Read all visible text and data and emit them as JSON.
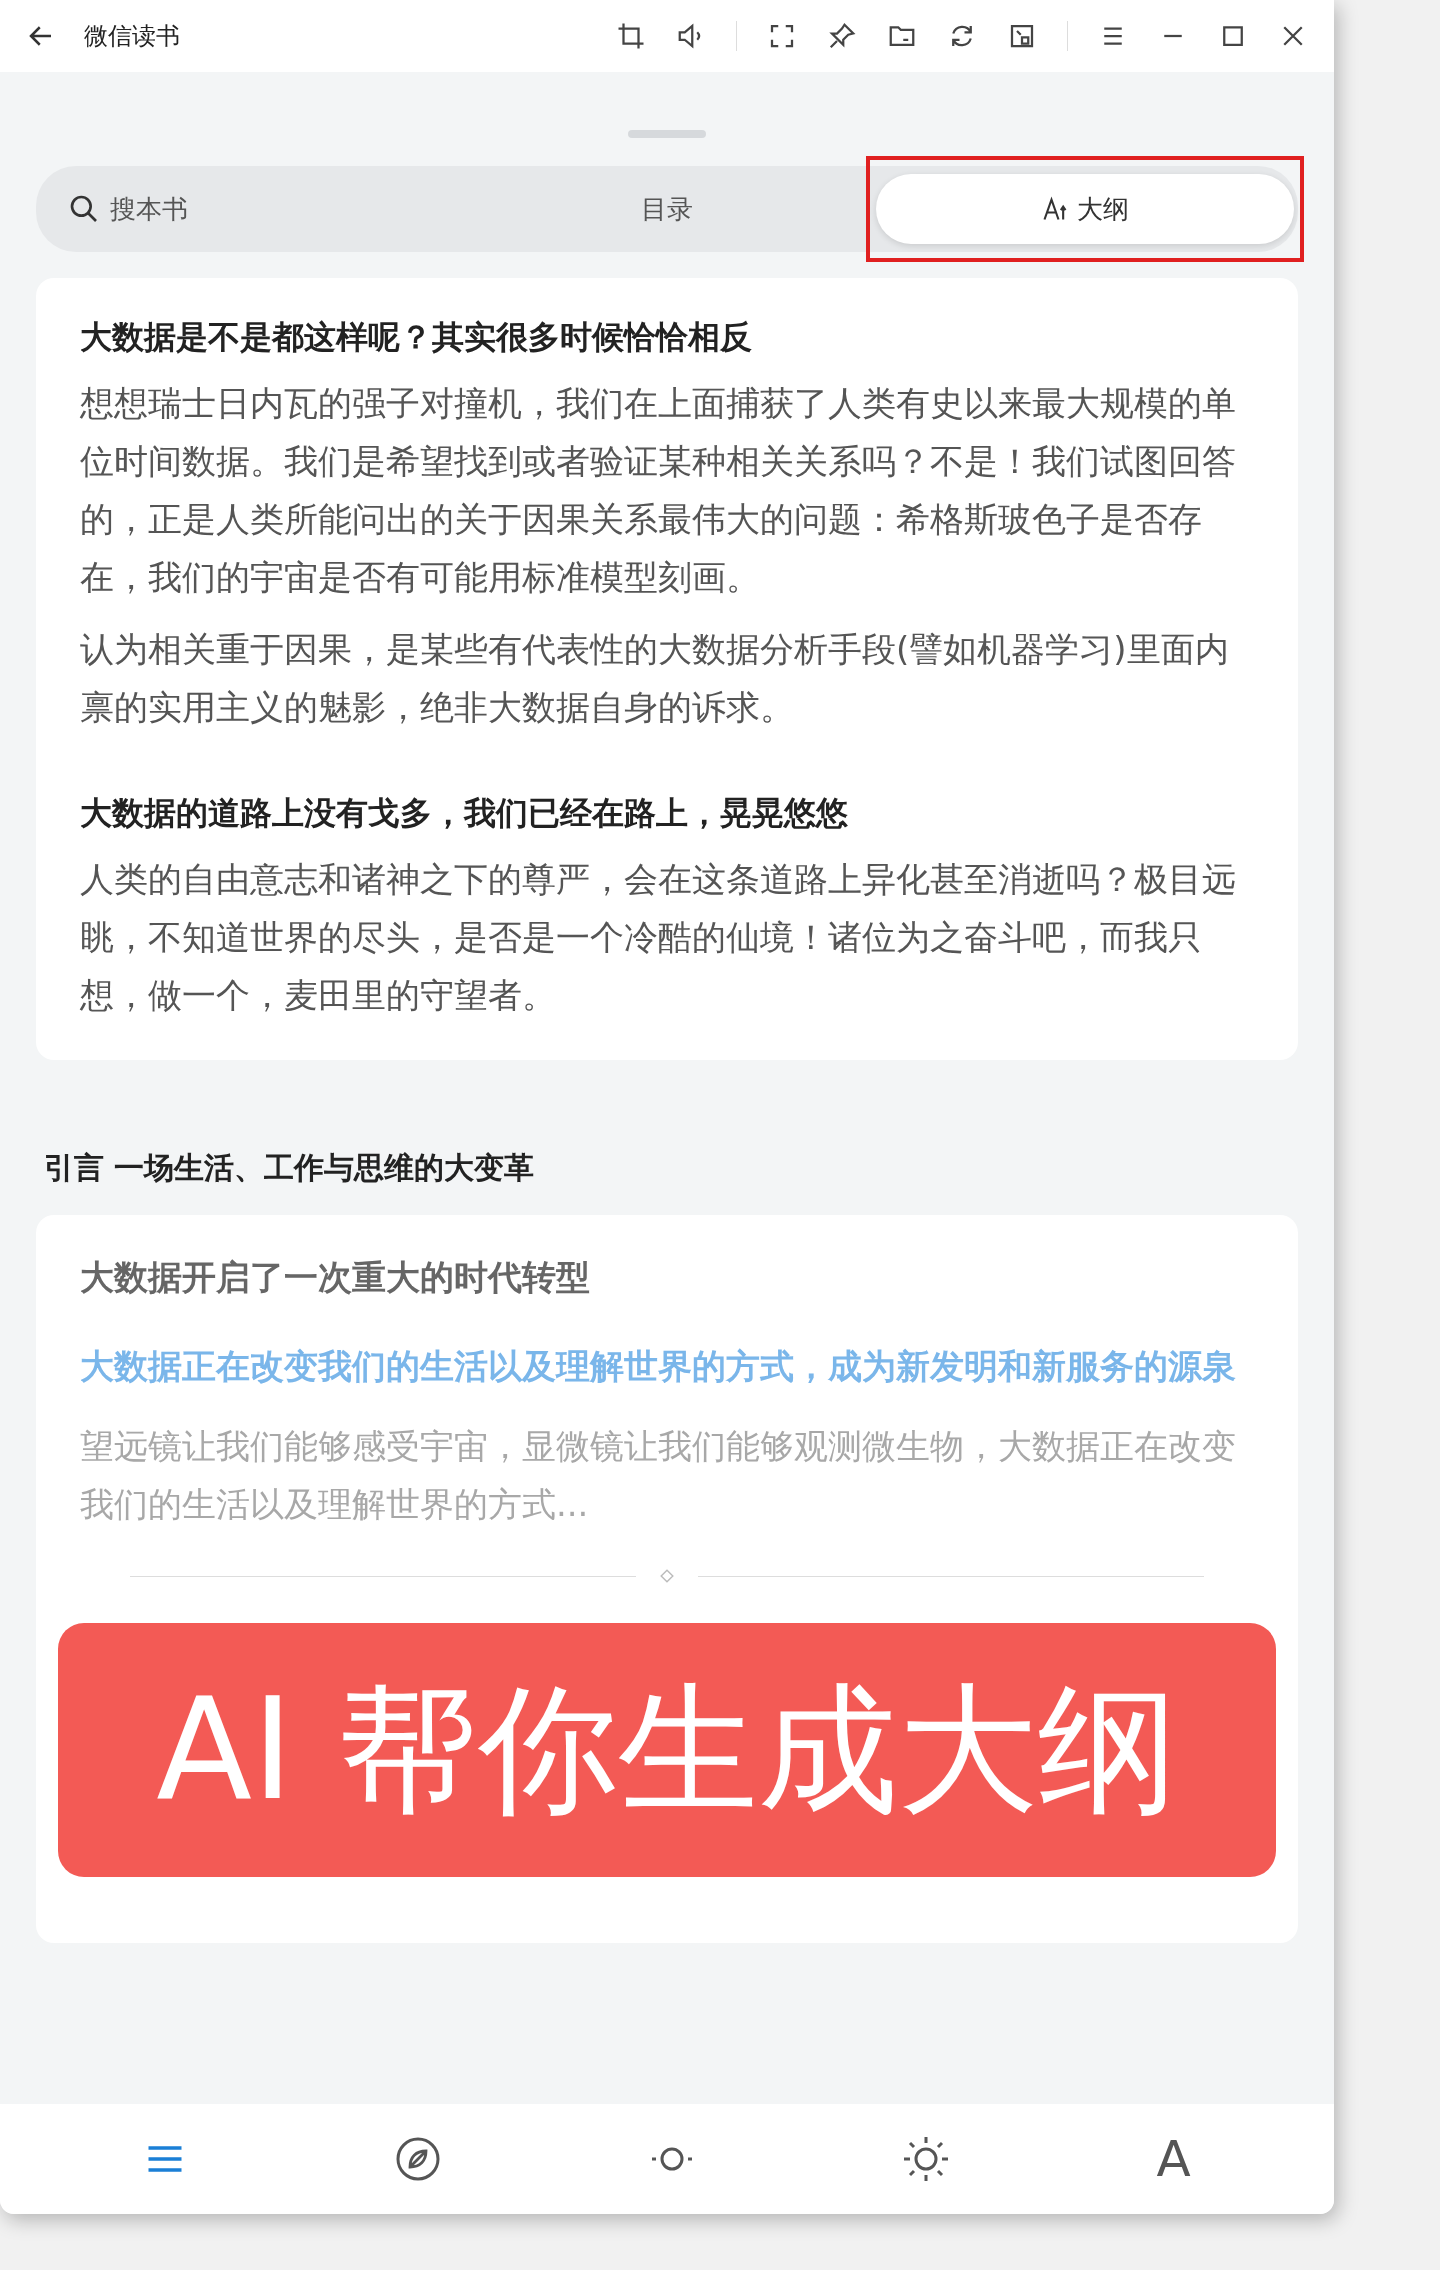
{
  "window": {
    "title": "微信读书"
  },
  "tabs": [
    {
      "kind": "search",
      "placeholder": "搜本书",
      "selected": false,
      "highlighted": false
    },
    {
      "kind": "plain",
      "label": "目录",
      "selected": false,
      "highlighted": false
    },
    {
      "kind": "ai",
      "label": "大纲",
      "selected": true,
      "highlighted": true
    }
  ],
  "card_1": {
    "sections": [
      {
        "heading": "大数据是不是都这样呢？其实很多时候恰恰相反",
        "paragraphs": [
          "想想瑞士日内瓦的强子对撞机，我们在上面捕获了人类有史以来最大规模的单位时间数据。我们是希望找到或者验证某种相关关系吗？不是！我们试图回答的，正是人类所能问出的关于因果关系最伟大的问题：希格斯玻色子是否存在，我们的宇宙是否有可能用标准模型刻画。",
          "认为相关重于因果，是某些有代表性的大数据分析手段(譬如机器学习)里面内禀的实用主义的魅影，绝非大数据自身的诉求。"
        ]
      },
      {
        "heading": "大数据的道路上没有戈多，我们已经在路上，晃晃悠悠",
        "paragraphs": [
          "人类的自由意志和诸神之下的尊严，会在这条道路上异化甚至消逝吗？极目远眺，不知道世界的尽头，是否是一个冷酷的仙境！诸位为之奋斗吧，而我只想，做一个，麦田里的守望者。"
        ]
      }
    ]
  },
  "chapter_title": "引言 一场生活、工作与思维的大变革",
  "card_2": {
    "title": "大数据开启了一次重大的时代转型",
    "highlight": "大数据正在改变我们的生活以及理解世界的方式，成为新发明和新服务的源泉",
    "faded_text": "望远镜让我们能够感受宇宙，显微镜让我们能够观测微生物，大数据正在改变我们的生活以及理解世界的方式..."
  },
  "banner": {
    "text": "AI 帮你生成大纲"
  },
  "bottom_bar": [
    {
      "kind": "menu",
      "selected": true
    },
    {
      "kind": "compass",
      "selected": false
    },
    {
      "kind": "dim",
      "selected": false
    },
    {
      "kind": "bright",
      "selected": false
    },
    {
      "kind": "font",
      "label": "A",
      "selected": false
    }
  ]
}
